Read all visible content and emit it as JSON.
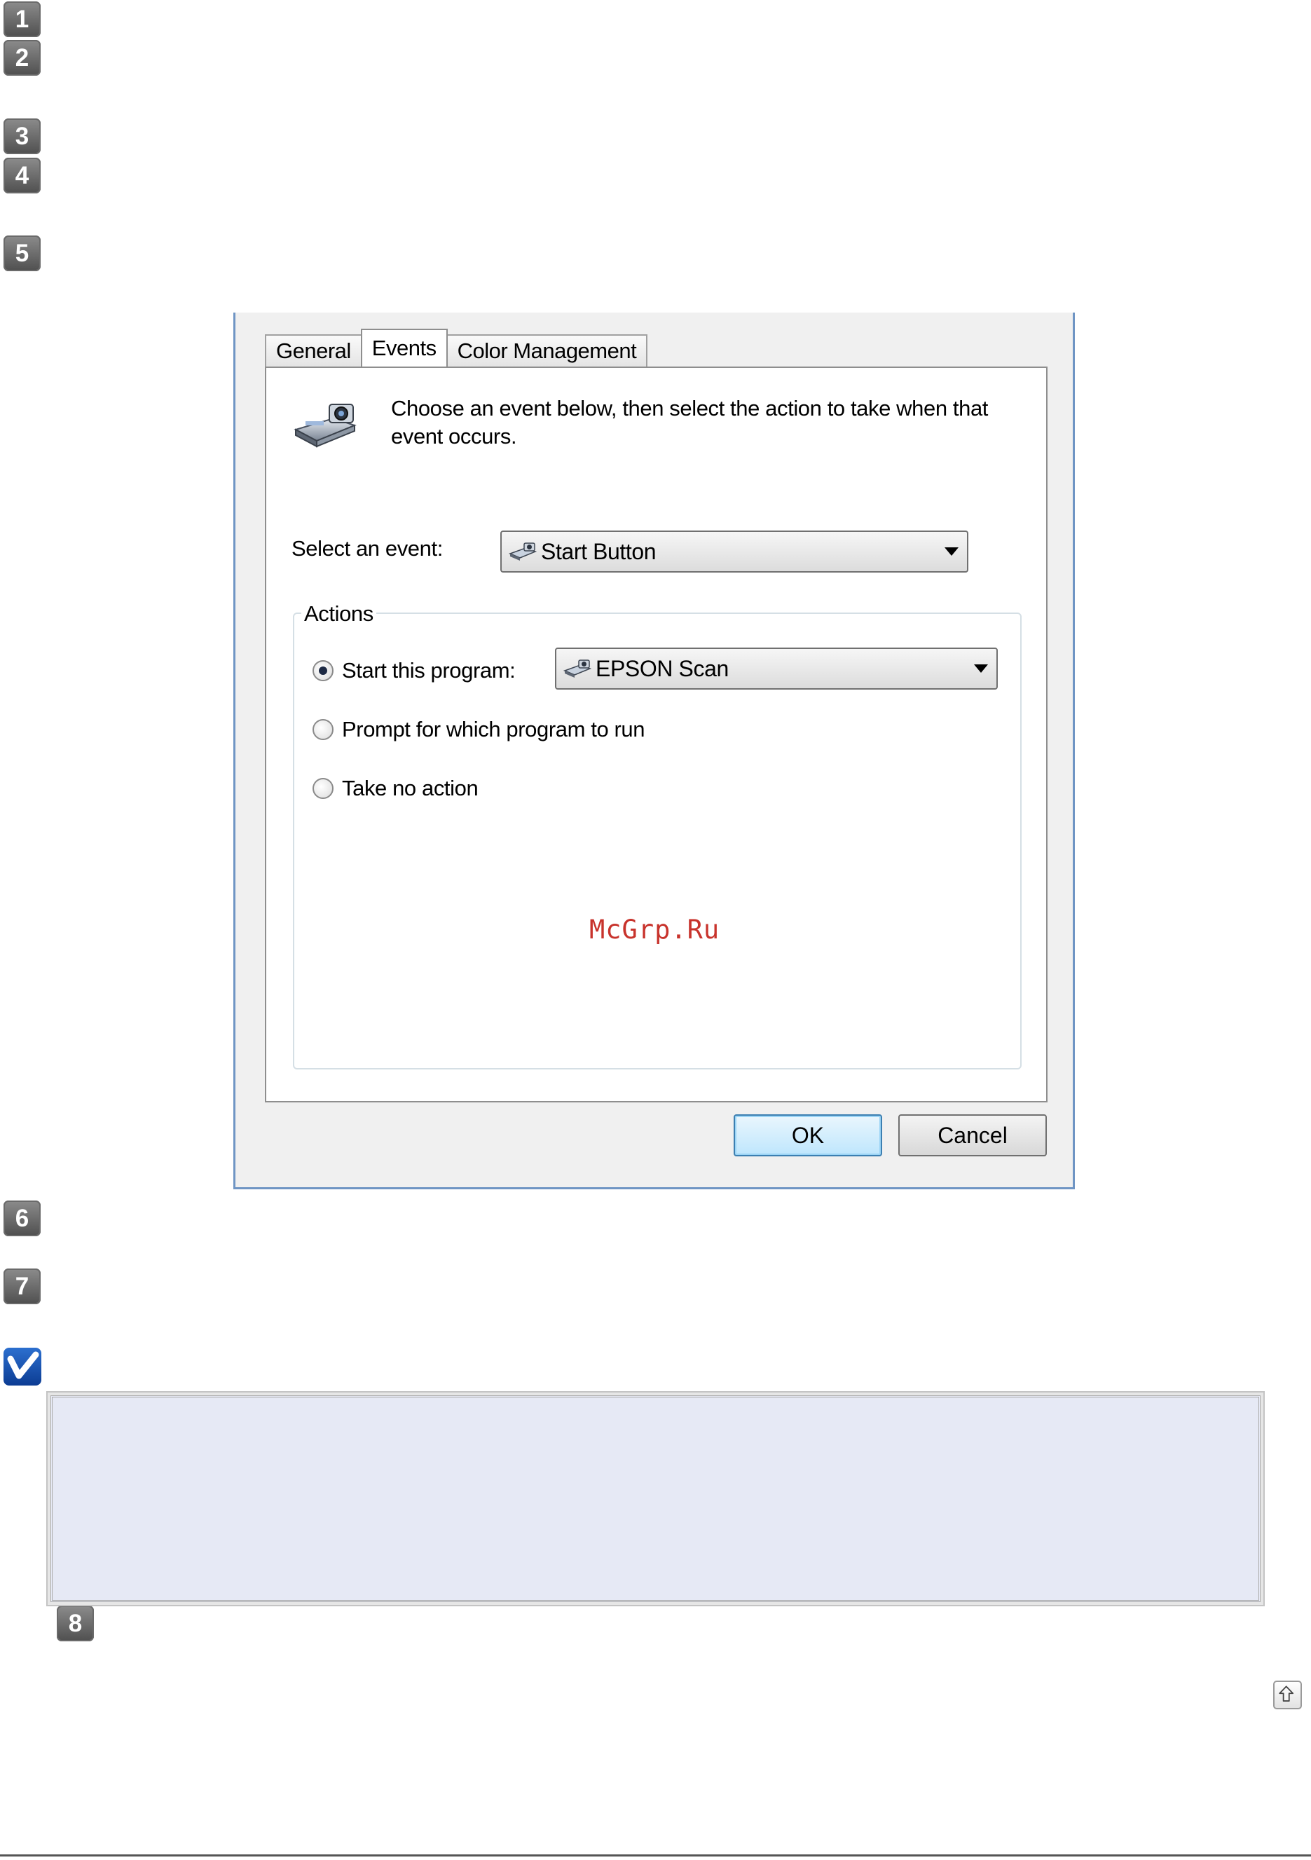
{
  "steps": [
    {
      "number": "1"
    },
    {
      "number": "2"
    },
    {
      "number": "3"
    },
    {
      "number": "4"
    },
    {
      "number": "5"
    },
    {
      "number": "6"
    },
    {
      "number": "7"
    },
    {
      "number": "8"
    }
  ],
  "dialog": {
    "tabs": [
      "General",
      "Events",
      "Color Management"
    ],
    "active_tab": "Events",
    "intro_text": "Choose an event below, then select the action to take when that event occurs.",
    "select_event_label": "Select an event:",
    "event_value": "Start Button",
    "actions_group_title": "Actions",
    "actions": {
      "start_program_label": "Start this program:",
      "start_program_value": "EPSON Scan",
      "prompt_label": "Prompt for which program to run",
      "no_action_label": "Take no action",
      "selected": "Start this program:"
    },
    "ok_label": "OK",
    "cancel_label": "Cancel"
  },
  "watermark": "McGrp.Ru",
  "colors": {
    "step_badge": "#4f4f4f",
    "dialog_border": "#6f95c4",
    "note_background": "#e6e9f5",
    "note_icon": "#0c3c93",
    "watermark": "#c8332c"
  },
  "icons": {
    "note": "checkmark-note-icon",
    "back_to_top": "arrow-up-icon",
    "device": "scanner-icon"
  }
}
